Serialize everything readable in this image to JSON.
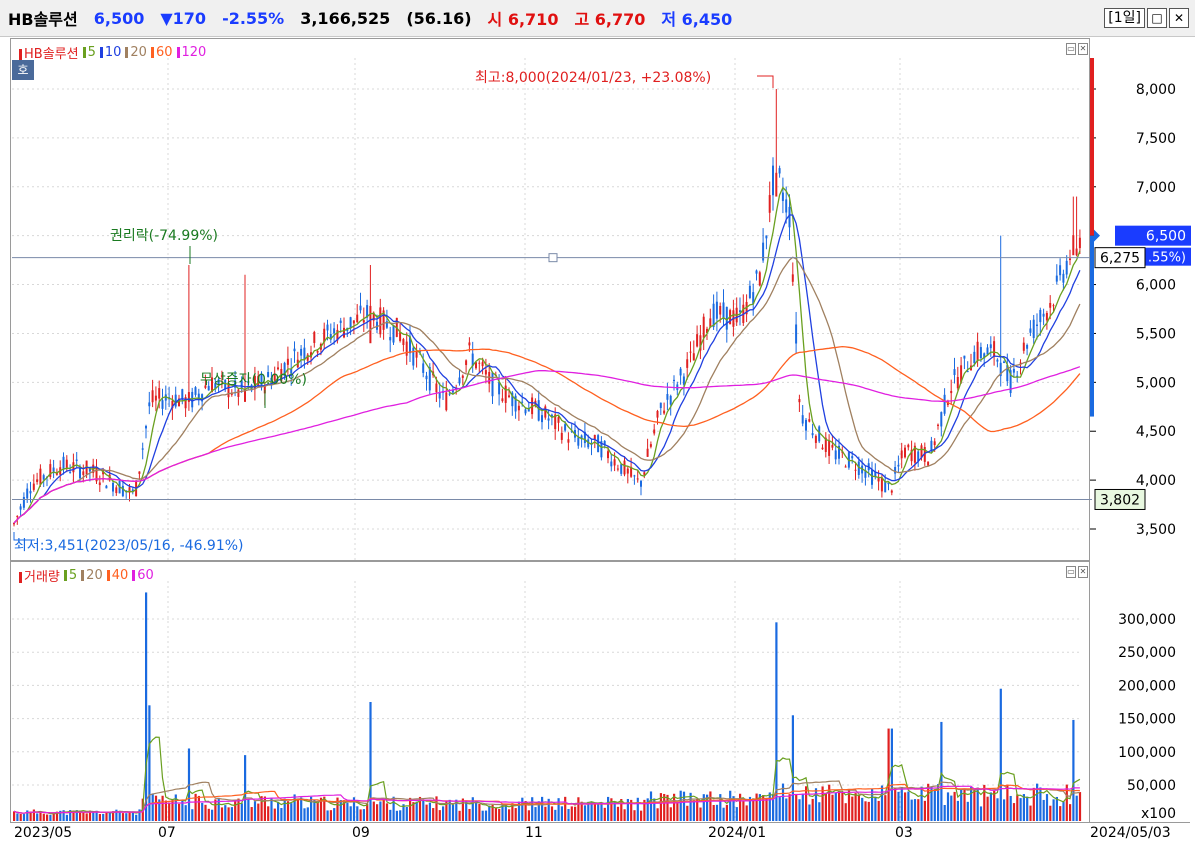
{
  "quote": {
    "name": "HB솔루션",
    "price": "6,500",
    "change": "▼170",
    "change_pct": "-2.55%",
    "volume": "3,166,525",
    "turnover_ratio": "(56.16)",
    "open": "시 6,710",
    "high": "고 6,770",
    "low": "저 6,450",
    "period": "[1일]"
  },
  "price_panel": {
    "legend": [
      {
        "label": "HB솔루션",
        "color": "#e02020"
      },
      {
        "label": "5",
        "color": "#6aa020"
      },
      {
        "label": "10",
        "color": "#2040e0"
      },
      {
        "label": "20",
        "color": "#a08060"
      },
      {
        "label": "60",
        "color": "#ff6020"
      },
      {
        "label": "120",
        "color": "#e020e0"
      }
    ],
    "ho_label": "호",
    "y_ticks": [
      "8,000",
      "7,500",
      "7,000",
      "6,500",
      "6,000",
      "5,500",
      "5,000",
      "4,500",
      "4,000",
      "3,500"
    ],
    "current_price_label": "6,500",
    "current_pct_label": ".55%)",
    "crosshair_label": "6,275",
    "low_line_label": "3,802",
    "annotation_high": "최고:8,000(2024/01/23, +23.08%)",
    "annotation_low": "최저:3,451(2023/05/16, -46.91%)",
    "annotation_rights": "권리락(-74.99%)",
    "annotation_other": "무상증자(0.00%)"
  },
  "volume_panel": {
    "legend": [
      {
        "label": "거래량",
        "color": "#e02020"
      },
      {
        "label": "5",
        "color": "#6aa020"
      },
      {
        "label": "20",
        "color": "#a08060"
      },
      {
        "label": "40",
        "color": "#ff6020"
      },
      {
        "label": "60",
        "color": "#e020e0"
      }
    ],
    "y_ticks": [
      "300,000",
      "250,000",
      "200,000",
      "150,000",
      "100,000",
      "50,000"
    ],
    "unit_label": "x100"
  },
  "x_axis": {
    "labels": [
      "2023/05",
      "07",
      "09",
      "11",
      "2024/01",
      "03",
      "2024/05/03"
    ]
  },
  "colors": {
    "up": "#e02020",
    "down": "#1a6ae0",
    "ma5": "#6aa020",
    "ma10": "#2040e0",
    "ma20": "#a08060",
    "ma60": "#ff6020",
    "ma120": "#e020e0"
  }
}
